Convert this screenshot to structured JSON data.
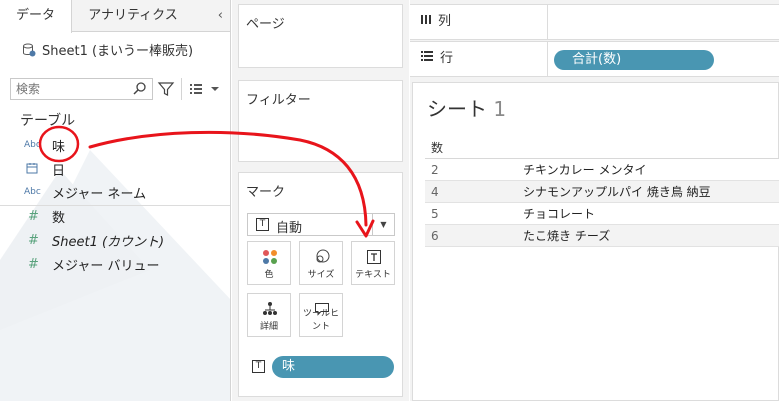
{
  "data_pane": {
    "tabs": [
      {
        "label": "データ"
      },
      {
        "label": "アナリティクス"
      }
    ],
    "collapse_icon": "chevron-left-icon",
    "datasource": "Sheet1 (まいうー棒販売)",
    "search": {
      "placeholder": "検索"
    },
    "section": "テーブル",
    "fields": [
      {
        "type": "Abc",
        "name": "味"
      },
      {
        "type": "date",
        "name": "日"
      },
      {
        "type": "Abc",
        "name": "メジャー ネーム"
      },
      {
        "type": "#",
        "name": "数"
      },
      {
        "type": "#",
        "name": "Sheet1 (カウント)"
      },
      {
        "type": "#",
        "name": "メジャー バリュー"
      }
    ]
  },
  "cards": {
    "pages": "ページ",
    "filters": "フィルター",
    "marks": {
      "title": "マーク",
      "mark_type": "自動",
      "buttons": [
        {
          "label": "色",
          "icon": "color-dots-icon"
        },
        {
          "label": "サイズ",
          "icon": "size-icon"
        },
        {
          "label": "テキスト",
          "icon": "text-icon"
        },
        {
          "label": "詳細",
          "icon": "detail-icon"
        },
        {
          "label": "ツールヒント",
          "icon": "tooltip-icon"
        }
      ],
      "pill": "味"
    }
  },
  "shelves": {
    "columns": {
      "label": "列",
      "icon": "columns-icon"
    },
    "rows": {
      "label": "行",
      "icon": "rows-icon",
      "pill": "合計(数)"
    }
  },
  "view": {
    "title": "シート",
    "title_num": "1",
    "header": "数",
    "rows": [
      {
        "num": "2",
        "text": "チキンカレー メンタイ"
      },
      {
        "num": "4",
        "text": "シナモンアップルパイ 焼き鳥 納豆"
      },
      {
        "num": "5",
        "text": "チョコレート"
      },
      {
        "num": "6",
        "text": "たこ焼き チーズ"
      }
    ]
  },
  "colors": {
    "accent_pill": "#4996b2",
    "annotation": "#e8141b",
    "measure_green": "#58a27c"
  }
}
